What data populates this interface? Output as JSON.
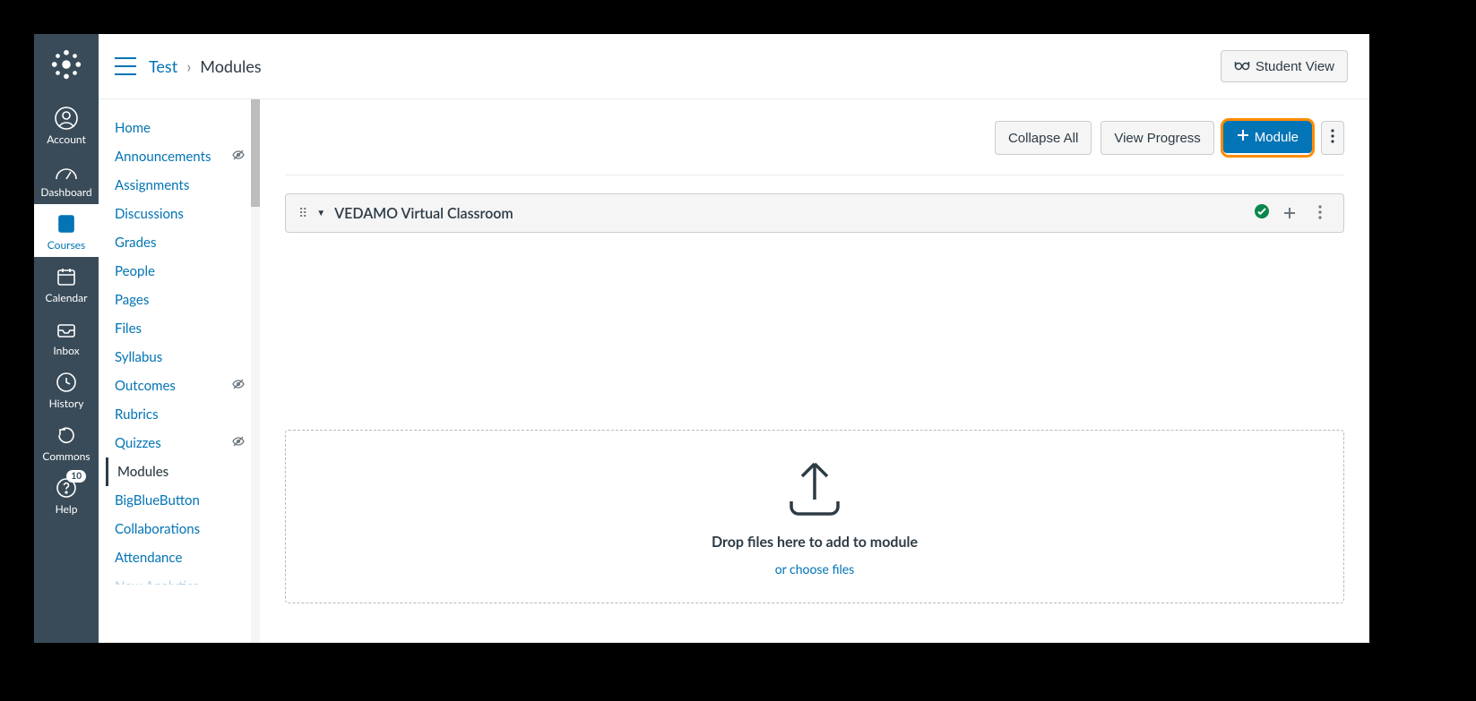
{
  "globalNav": {
    "items": [
      {
        "label": "Account"
      },
      {
        "label": "Dashboard"
      },
      {
        "label": "Courses"
      },
      {
        "label": "Calendar"
      },
      {
        "label": "Inbox"
      },
      {
        "label": "History"
      },
      {
        "label": "Commons"
      },
      {
        "label": "Help",
        "badge": "10"
      }
    ]
  },
  "breadcrumb": {
    "course": "Test",
    "page": "Modules"
  },
  "studentView": "Student View",
  "courseNav": {
    "items": [
      {
        "label": "Home"
      },
      {
        "label": "Announcements",
        "hidden": true
      },
      {
        "label": "Assignments"
      },
      {
        "label": "Discussions"
      },
      {
        "label": "Grades"
      },
      {
        "label": "People"
      },
      {
        "label": "Pages"
      },
      {
        "label": "Files"
      },
      {
        "label": "Syllabus"
      },
      {
        "label": "Outcomes",
        "hidden": true
      },
      {
        "label": "Rubrics"
      },
      {
        "label": "Quizzes",
        "hidden": true
      },
      {
        "label": "Modules",
        "active": true
      },
      {
        "label": "BigBlueButton"
      },
      {
        "label": "Collaborations"
      },
      {
        "label": "Attendance"
      },
      {
        "label": "New Analytics"
      }
    ]
  },
  "toolbar": {
    "collapse": "Collapse All",
    "progress": "View Progress",
    "addModule": "Module"
  },
  "module": {
    "title": "VEDAMO Virtual Classroom"
  },
  "dropzone": {
    "title": "Drop files here to add to module",
    "choose": "or choose files"
  }
}
